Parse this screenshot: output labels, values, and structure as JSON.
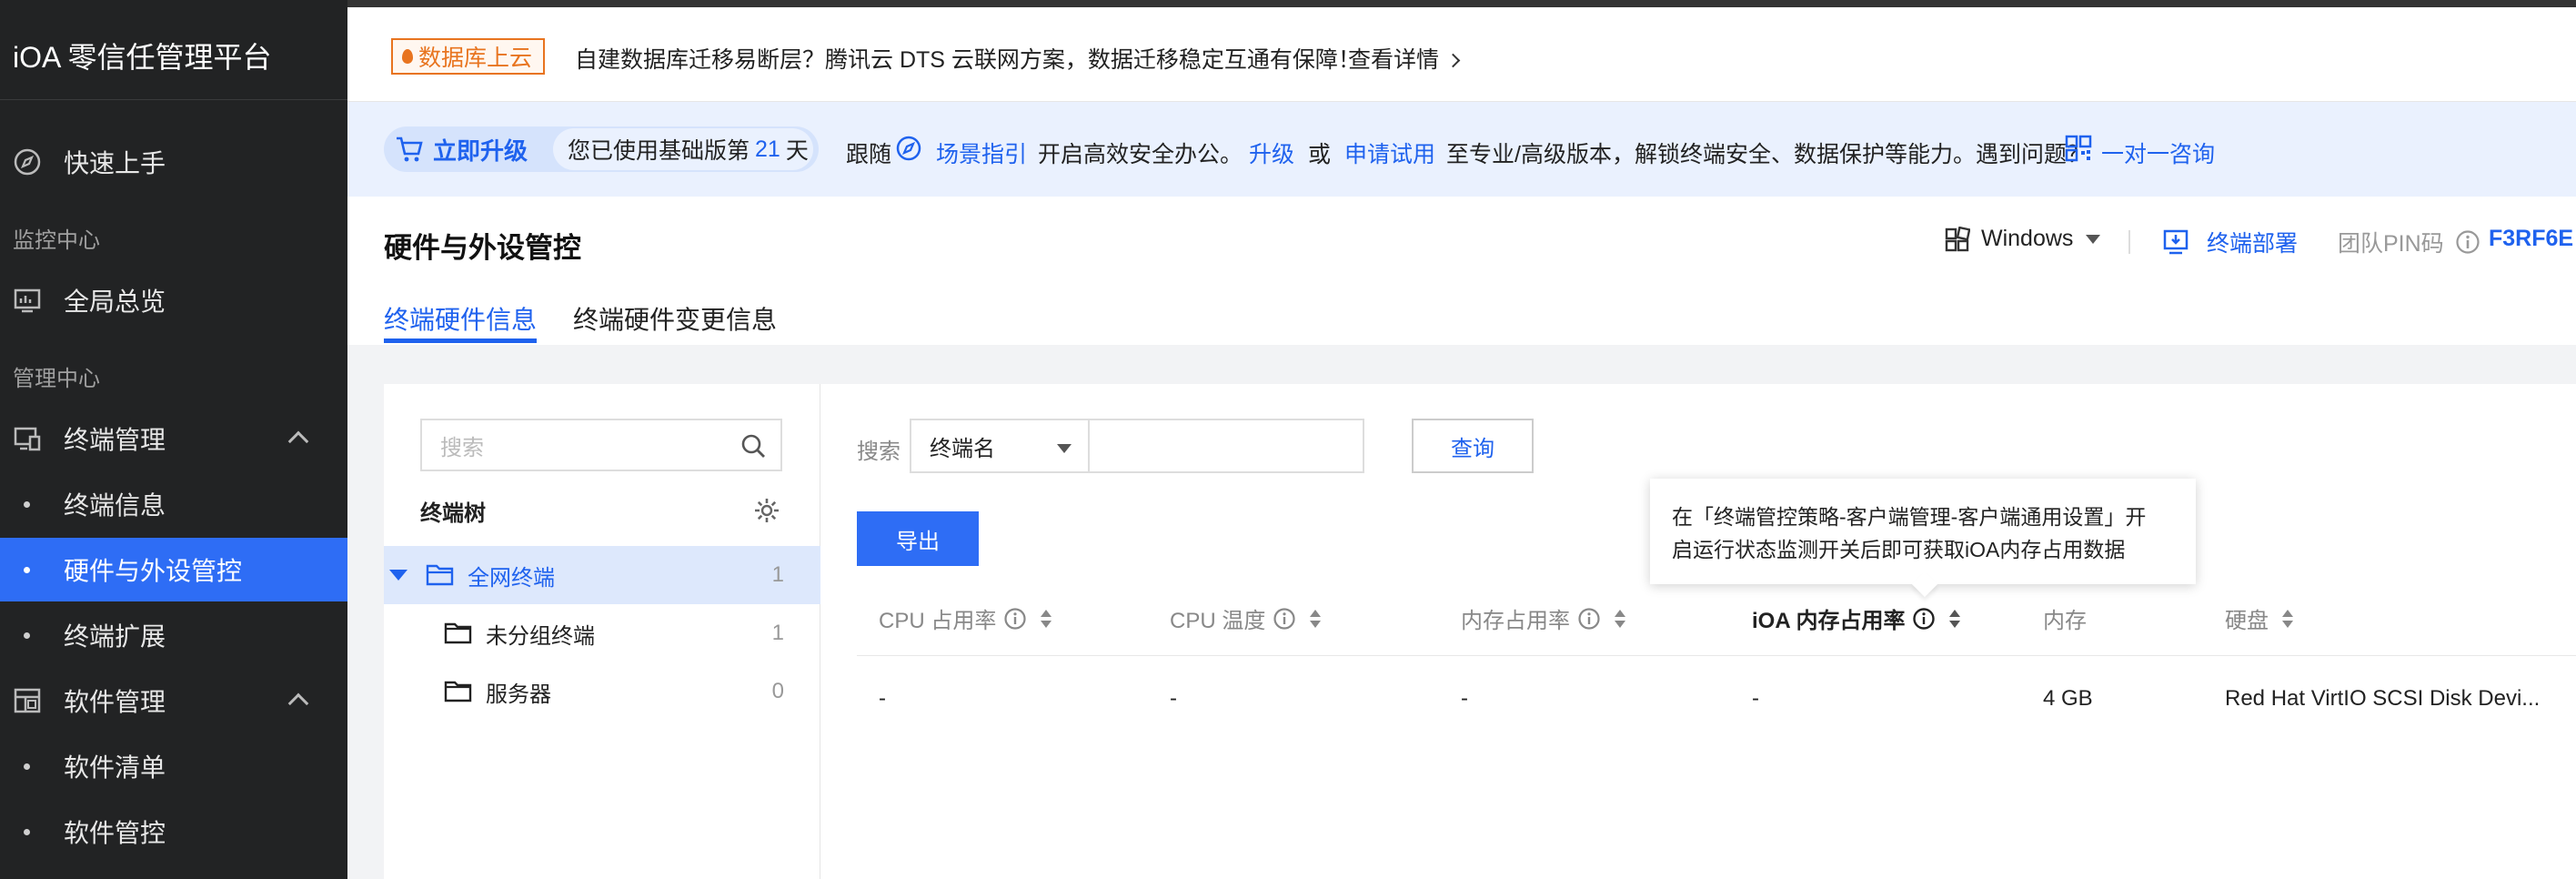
{
  "app": {
    "title": "iOA 零信任管理平台"
  },
  "sidebar": {
    "quickstart": "快速上手",
    "group_monitor": "监控中心",
    "overview": "全局总览",
    "group_manage": "管理中心",
    "endpoint_mgmt": "终端管理",
    "endpoint_info": "终端信息",
    "hardware": "硬件与外设管控",
    "endpoint_ext": "终端扩展",
    "software_mgmt": "软件管理",
    "software_list": "软件清单",
    "software_ctrl": "软件管控"
  },
  "notice": {
    "tag": "数据库上云",
    "text": "自建数据库迁移易断层？腾讯云 DTS 云联网方案，数据迁移稳定互通有保障！",
    "link": "查看详情"
  },
  "banner": {
    "upgrade": "立即升级",
    "days_prefix": "您已使用基础版第",
    "days": "21",
    "days_suffix": "天",
    "follow": "跟随",
    "guide": "场景指引",
    "office": "开启高效安全办公。",
    "upgrade_link": "升级",
    "or": "或",
    "trial": "申请试用",
    "tail": "至专业/高级版本，解锁终端安全、数据保护等能力。遇到问题？",
    "consult": "一对一咨询"
  },
  "page": {
    "title": "硬件与外设管控",
    "tab1": "终端硬件信息",
    "tab2": "终端硬件变更信息",
    "os": "Windows",
    "deploy": "终端部署",
    "pin_label": "团队PIN码",
    "pin": "F3RF6E"
  },
  "tree": {
    "search_placeholder": "搜索",
    "title": "终端树",
    "nodes": [
      {
        "label": "全网终端",
        "count": "1"
      },
      {
        "label": "未分组终端",
        "count": "1"
      },
      {
        "label": "服务器",
        "count": "0"
      }
    ]
  },
  "filter": {
    "search_label": "搜索",
    "field": "终端名",
    "query": "查询",
    "export": "导出"
  },
  "table": {
    "headers": [
      "CPU 占用率",
      "CPU 温度",
      "内存占用率",
      "iOA 内存占用率",
      "内存",
      "硬盘"
    ],
    "row": [
      "-",
      "-",
      "-",
      "-",
      "4 GB",
      "Red Hat VirtIO SCSI Disk Devi..."
    ]
  },
  "tooltip": {
    "line1": "在「终端管控策略-客户端管理-客户端通用设置」开",
    "line2": "启运行状态监测开关后即可获取iOA内存占用数据"
  },
  "colors": {
    "accent": "#2e6df5",
    "sidebar": "#222324",
    "tag": "#e8741f"
  }
}
